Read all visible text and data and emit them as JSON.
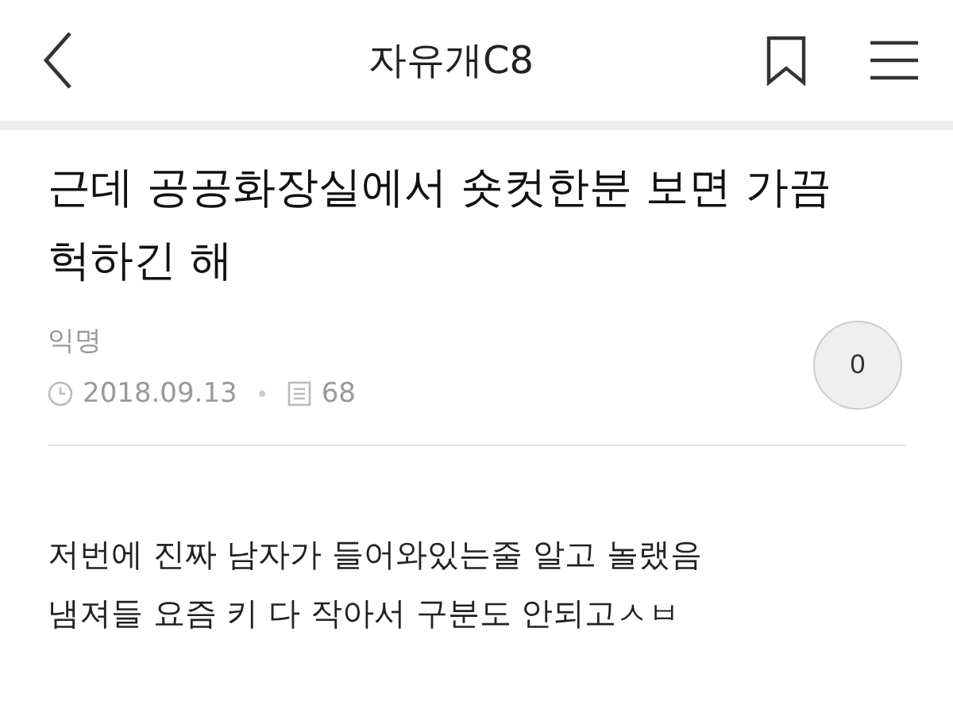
{
  "header": {
    "title": "자유개C8"
  },
  "post": {
    "title": "근데 공공화장실에서 숏컷한분 보면 가끔 헉하긴 해",
    "author": "익명",
    "date": "2018.09.13",
    "views": "68",
    "comment_count": "0"
  },
  "body": [
    "저번에 진짜 남자가 들어와있는줄 알고 놀랬음",
    "냄져들 요즘 키 다 작아서 구분도 안되고ㅅㅂ"
  ]
}
